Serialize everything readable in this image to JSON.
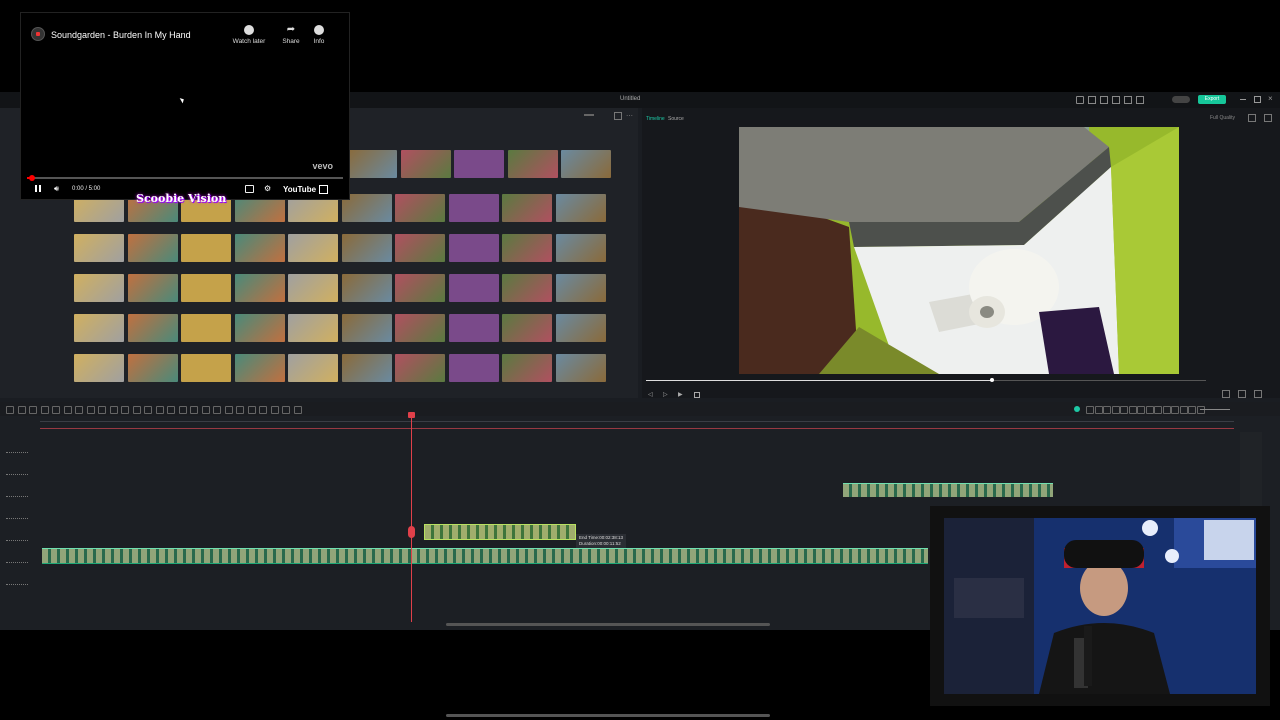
{
  "youtube": {
    "title": "Soundgarden - Burden In My Hand",
    "watch_later": "Watch later",
    "share": "Share",
    "info": "Info",
    "brand": "vevo",
    "time": "0:00 / 5:00",
    "progress": 0.02,
    "logo_text": "YouTube"
  },
  "overlay_text": "Scoobie Vision",
  "editor": {
    "window_title": "Untitled",
    "preview_tabs": [
      "Timeline",
      "Source"
    ],
    "quality": "Full Quality",
    "export_label": "Export",
    "clip_tooltip": {
      "end_time": "End Time:00:02:38:13",
      "duration": "Duration:00:00:11:52"
    }
  },
  "colors": {
    "accent": "#1ec8a5",
    "playhead": "#e0404a",
    "export": "#16c79a"
  }
}
